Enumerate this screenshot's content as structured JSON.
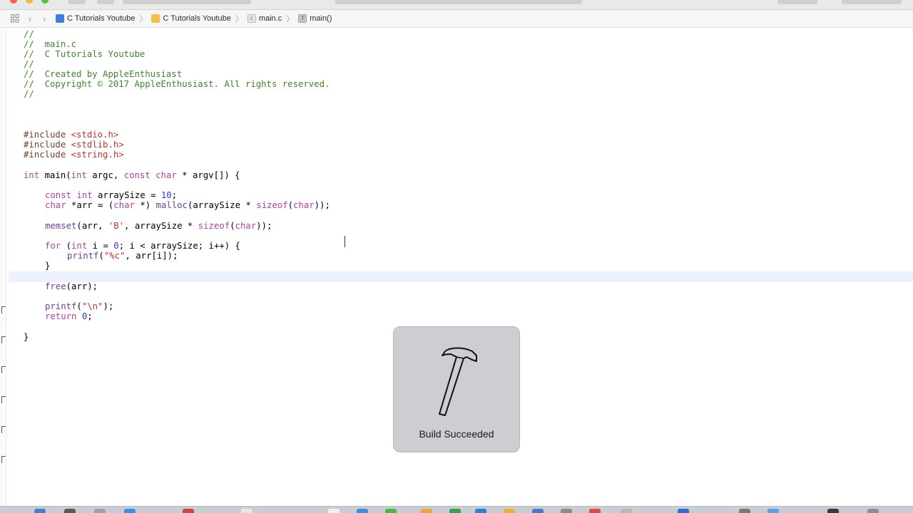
{
  "jumpbar": {
    "crumbs": [
      {
        "label": "C Tutorials Youtube",
        "icon": "project-icon"
      },
      {
        "label": "C Tutorials Youtube",
        "icon": "folder-icon"
      },
      {
        "label": "main.c",
        "icon": "c-file-icon"
      },
      {
        "label": "main()",
        "icon": "function-icon"
      }
    ],
    "cfile_glyph": "c",
    "func_glyph": "f"
  },
  "code": {
    "l1": "//",
    "l2": "//  main.c",
    "l3": "//  C Tutorials Youtube",
    "l4": "//",
    "l5": "//  Created by AppleEnthusiast",
    "l6": "//  Copyright © 2017 AppleEnthusiast. All rights reserved.",
    "l7": "//",
    "inc1_dir": "#include",
    "inc1_file": "<stdio.h>",
    "inc2_dir": "#include",
    "inc2_file": "<stdlib.h>",
    "inc3_dir": "#include",
    "inc3_file": "<string.h>",
    "sig_int": "int",
    "sig_main": " main(",
    "sig_int2": "int",
    "sig_argc": " argc, ",
    "sig_const": "const",
    "sig_sp": " ",
    "sig_char": "char",
    "sig_rest": " * argv[]) {",
    "a_const": "const",
    "a_sp": " ",
    "a_int": "int",
    "a_mid": " arraySize = ",
    "a_num": "10",
    "a_end": ";",
    "b_char": "char",
    "b_mid": " *arr = (",
    "b_char2": "char",
    "b_mid2": " *) ",
    "b_malloc": "malloc",
    "b_mid3": "(arraySize * ",
    "b_sizeof": "sizeof",
    "b_paren": "(",
    "b_char3": "char",
    "b_end": "));",
    "m_fn": "memset",
    "m_mid": "(arr, ",
    "m_str": "'B'",
    "m_mid2": ", arraySize * ",
    "m_sizeof": "sizeof",
    "m_paren": "(",
    "m_char": "char",
    "m_end": "));",
    "f_for": "for",
    "f_mid": " (",
    "f_int": "int",
    "f_mid2": " i = ",
    "f_num": "0",
    "f_end": "; i < arraySize; i++) {",
    "p_fn": "printf",
    "p_paren": "(",
    "p_str": "\"%c\"",
    "p_end": ", arr[i]);",
    "close1": "}",
    "free_fn": "free",
    "free_end": "(arr);",
    "p2_fn": "printf",
    "p2_paren": "(",
    "p2_str": "\"\\n\"",
    "p2_end": ");",
    "r_kw": "return",
    "r_sp": " ",
    "r_num": "0",
    "r_end": ";",
    "close2": "}"
  },
  "hud": {
    "label": "Build Succeeded",
    "icon": "hammer-icon"
  },
  "colors": {
    "comment": "#41852b",
    "preprocessor": "#7b3d2b",
    "string": "#c4352a",
    "keyword": "#b13fa0",
    "number": "#2f36d6",
    "function": "#6e3ea2",
    "current_line": "#ecf2fb",
    "hud_bg": "#cdcdd2"
  }
}
